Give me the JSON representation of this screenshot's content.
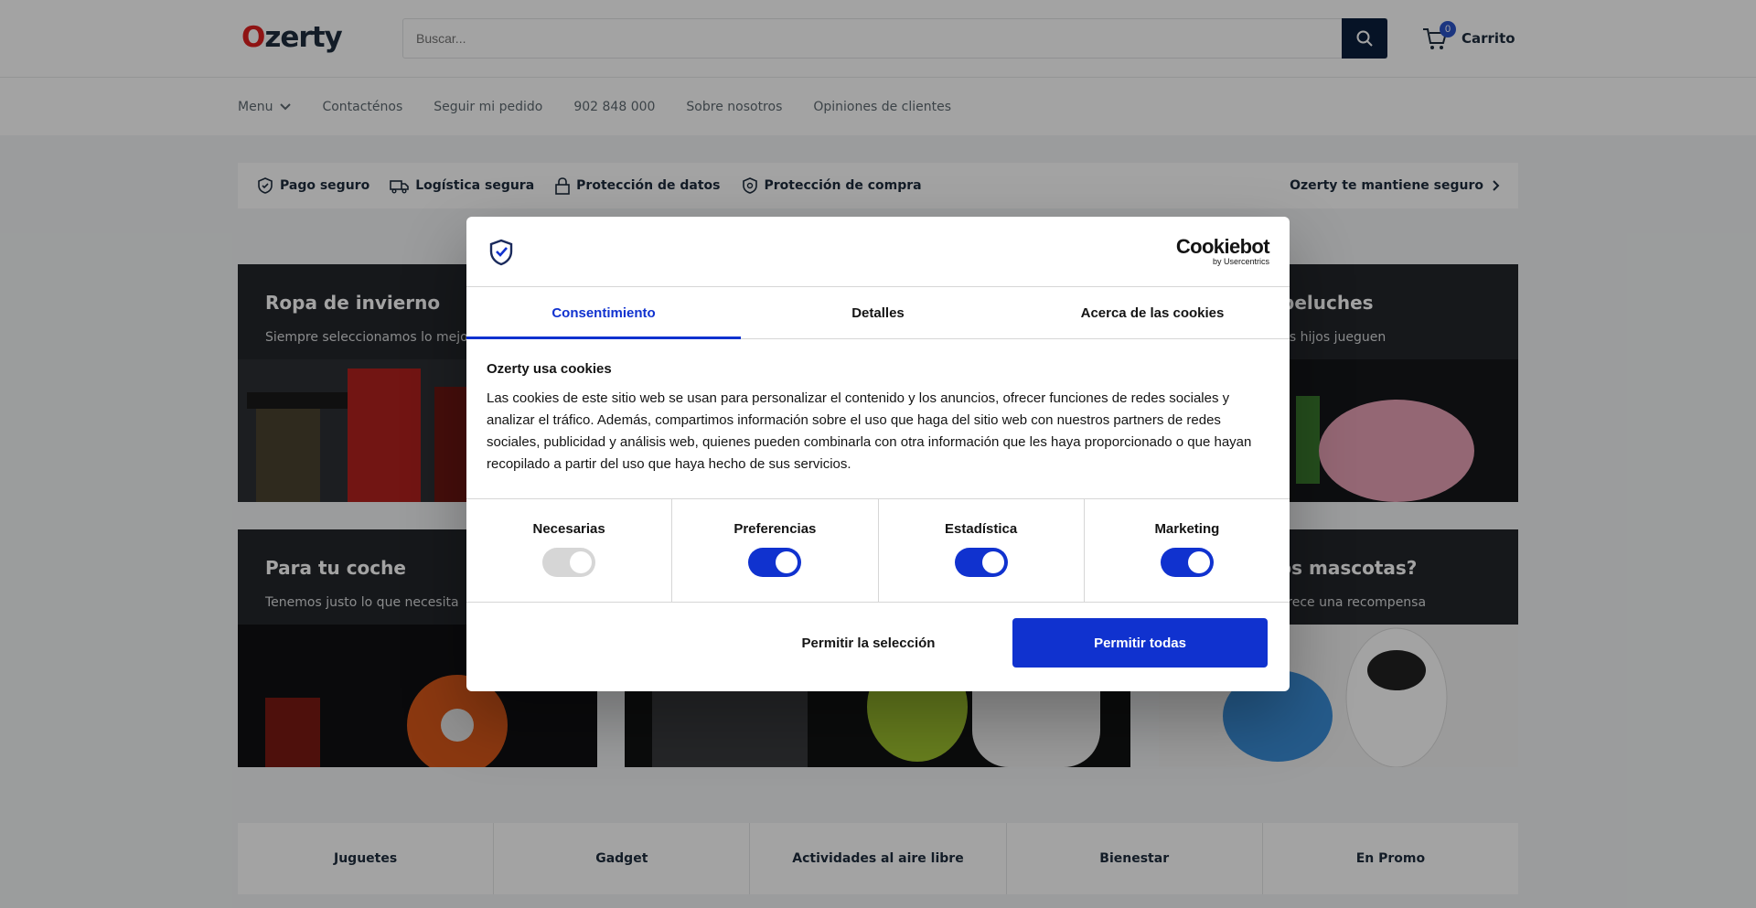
{
  "header": {
    "logo_text": "Ozerty",
    "search_placeholder": "Buscar...",
    "cart_count": "0",
    "cart_label": "Carrito"
  },
  "nav": {
    "items": [
      "Menu",
      "Contacténos",
      "Seguir mi pedido",
      "902 848 000",
      "Sobre nosotros",
      "Opiniones de clientes"
    ]
  },
  "trust": {
    "items": [
      "Pago seguro",
      "Logística segura",
      "Protección de datos",
      "Protección de compra"
    ],
    "right_link": "Ozerty te mantiene seguro"
  },
  "cards": [
    {
      "title": "Ropa de invierno",
      "subtitle": "Siempre seleccionamos lo mejo"
    },
    {
      "title": "peluches",
      "subtitle": "us hijos jueguen"
    },
    {
      "title": "Para tu coche",
      "subtitle": "Tenemos justo lo que necesita"
    },
    {
      "title": "e los mascotas?",
      "subtitle": "merece una recompensa"
    }
  ],
  "categories": [
    "Juguetes",
    "Gadget",
    "Actividades al aire libre",
    "Bienestar",
    "En Promo"
  ],
  "consent": {
    "brand_big": "Cookiebot",
    "brand_small": "by Usercentrics",
    "tabs": [
      "Consentimiento",
      "Detalles",
      "Acerca de las cookies"
    ],
    "heading": "Ozerty usa cookies",
    "body": "Las cookies de este sitio web se usan para personalizar el contenido y los anuncios, ofrecer funciones de redes sociales y analizar el tráfico. Además, compartimos información sobre el uso que haga del sitio web con nuestros partners de redes sociales, publicidad y análisis web, quienes pueden combinarla con otra información que les haya proporcionado o que hayan recopilado a partir del uso que haya hecho de sus servicios.",
    "toggles": [
      {
        "label": "Necesarias",
        "state": "on-disabled"
      },
      {
        "label": "Preferencias",
        "state": "on"
      },
      {
        "label": "Estadística",
        "state": "on"
      },
      {
        "label": "Marketing",
        "state": "on"
      }
    ],
    "btn_selection": "Permitir la selección",
    "btn_all": "Permitir todas"
  },
  "colors": {
    "accent": "#1032cf",
    "nav_dark": "#0a1e3c",
    "logo_red": "#e02020"
  }
}
